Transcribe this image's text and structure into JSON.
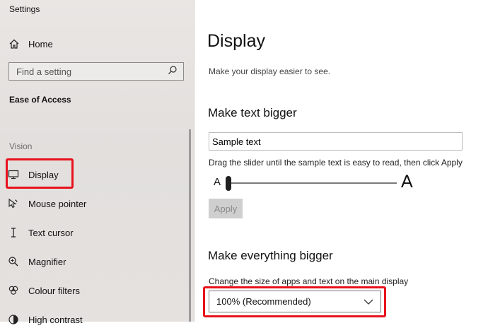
{
  "window": {
    "title": "Settings"
  },
  "sidebar": {
    "home_label": "Home",
    "search_placeholder": "Find a setting",
    "section_title": "Ease of Access",
    "group_label": "Vision",
    "items": [
      {
        "label": "Display",
        "icon": "monitor-icon",
        "selected": true
      },
      {
        "label": "Mouse pointer",
        "icon": "mouse-pointer-icon"
      },
      {
        "label": "Text cursor",
        "icon": "text-cursor-icon"
      },
      {
        "label": "Magnifier",
        "icon": "magnifier-icon"
      },
      {
        "label": "Colour filters",
        "icon": "colour-filters-icon"
      },
      {
        "label": "High contrast",
        "icon": "high-contrast-icon"
      }
    ]
  },
  "main": {
    "title": "Display",
    "description": "Make your display easier to see.",
    "text_bigger": {
      "heading": "Make text bigger",
      "sample_text": "Sample text",
      "hint": "Drag the slider until the sample text is easy to read, then click Apply",
      "slider_min_label": "A",
      "slider_max_label": "A",
      "slider_value_fraction": 0,
      "apply_label": "Apply"
    },
    "everything_bigger": {
      "heading": "Make everything bigger",
      "description": "Change the size of apps and text on the main display",
      "scale_value": "100% (Recommended)"
    }
  },
  "colors": {
    "highlight": "#e8121c",
    "sidebar_bg": "#e6e3e1"
  }
}
